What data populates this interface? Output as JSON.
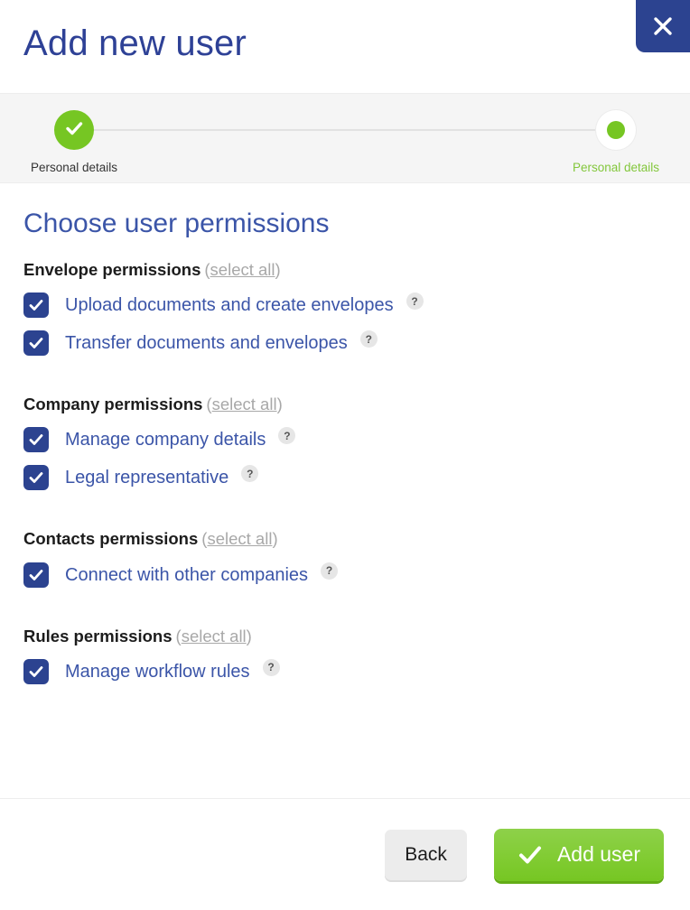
{
  "header": {
    "title": "Add new user",
    "close_label": "close-icon"
  },
  "stepper": {
    "steps": [
      {
        "label": "Personal details",
        "state": "done"
      },
      {
        "label": "Personal details",
        "state": "current"
      }
    ]
  },
  "main": {
    "section_title": "Choose user permissions",
    "select_all_label": "select all",
    "groups": [
      {
        "title": "Envelope permissions",
        "items": [
          {
            "label": "Upload documents and create envelopes",
            "checked": true,
            "help": "?"
          },
          {
            "label": "Transfer documents and envelopes",
            "checked": true,
            "help": "?"
          }
        ]
      },
      {
        "title": "Company permissions",
        "items": [
          {
            "label": "Manage company details",
            "checked": true,
            "help": "?"
          },
          {
            "label": "Legal representative",
            "checked": true,
            "help": "?"
          }
        ]
      },
      {
        "title": "Contacts permissions",
        "items": [
          {
            "label": "Connect with other companies",
            "checked": true,
            "help": "?"
          }
        ]
      },
      {
        "title": "Rules permissions",
        "items": [
          {
            "label": "Manage workflow rules",
            "checked": true,
            "help": "?"
          }
        ]
      }
    ]
  },
  "footer": {
    "back_label": "Back",
    "add_label": "Add user"
  },
  "colors": {
    "brand_blue": "#2c4390",
    "title_blue": "#2e4196",
    "label_blue": "#3b55a8",
    "green": "#76c623",
    "green_light": "#8ed14a",
    "muted_gray": "#a8a8a8",
    "band_gray": "#f5f5f5"
  }
}
